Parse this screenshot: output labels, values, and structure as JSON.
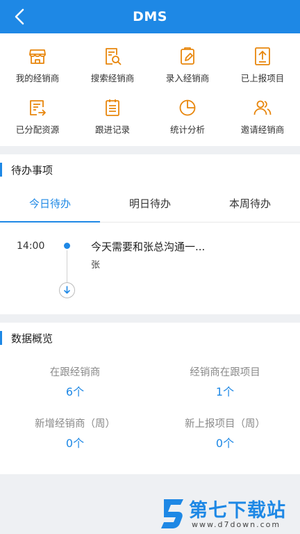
{
  "header": {
    "title": "DMS",
    "back_icon": "chevron-left-icon"
  },
  "grid": [
    {
      "label": "我的经销商",
      "icon": "store-icon"
    },
    {
      "label": "搜索经销商",
      "icon": "search-document-icon"
    },
    {
      "label": "录入经销商",
      "icon": "edit-clipboard-icon"
    },
    {
      "label": "已上报项目",
      "icon": "upload-report-icon"
    },
    {
      "label": "已分配资源",
      "icon": "assign-resource-icon"
    },
    {
      "label": "跟进记录",
      "icon": "notepad-icon"
    },
    {
      "label": "统计分析",
      "icon": "pie-chart-icon"
    },
    {
      "label": "邀请经销商",
      "icon": "invite-users-icon"
    }
  ],
  "todo": {
    "section_title": "待办事项",
    "tabs": [
      "今日待办",
      "明日待办",
      "本周待办"
    ],
    "active_tab": 0,
    "items": [
      {
        "time": "14:00",
        "title": "今天需要和张总沟通一...",
        "subtitle": "张"
      }
    ]
  },
  "overview": {
    "section_title": "数据概览",
    "stats": [
      {
        "label": "在跟经销商",
        "value": "6个"
      },
      {
        "label": "经销商在跟项目",
        "value": "1个"
      },
      {
        "label": "新增经销商（周）",
        "value": "0个"
      },
      {
        "label": "新上报项目（周）",
        "value": "0个"
      }
    ]
  },
  "watermark": {
    "text": "第七下载站",
    "url": "www.d7down.com"
  },
  "colors": {
    "primary": "#1e88e5",
    "background": "#eef0f3"
  }
}
